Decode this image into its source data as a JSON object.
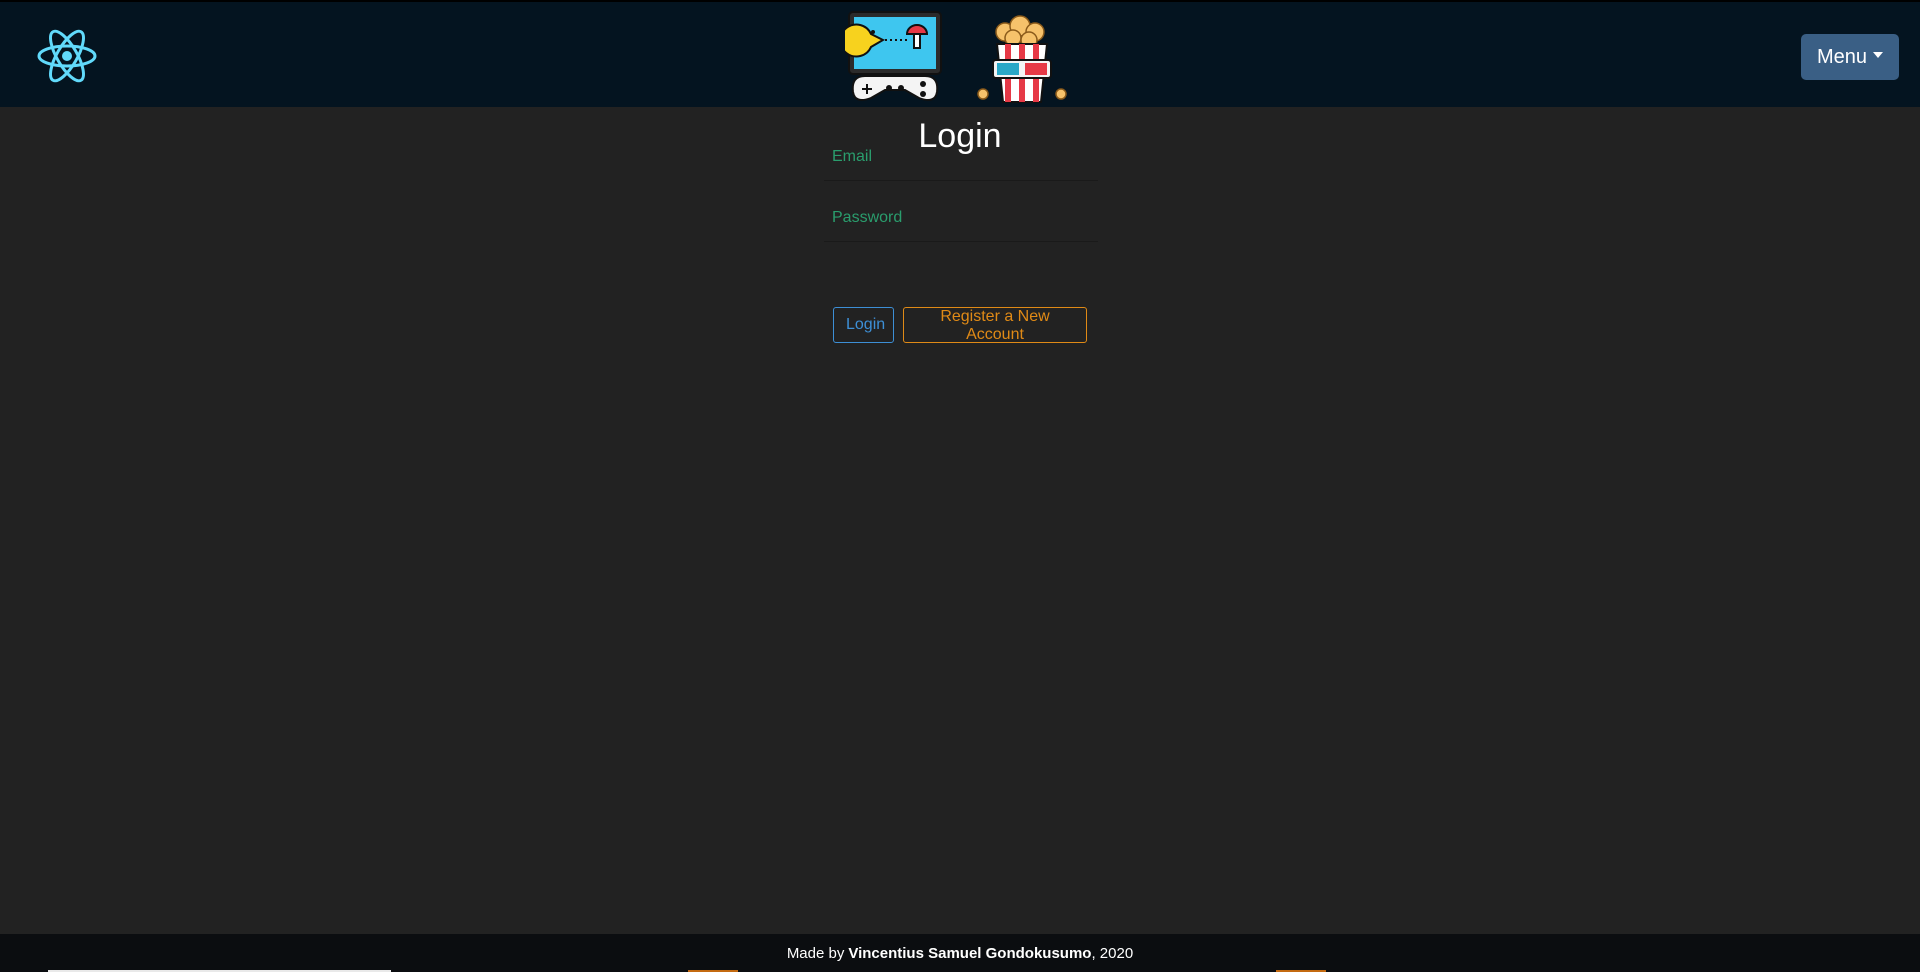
{
  "navbar": {
    "brand_icon": "react-atom-icon",
    "center_icons": [
      "gamepad-monitor-icon",
      "popcorn-3d-glasses-icon"
    ],
    "menu_label": "Menu",
    "colors": {
      "background": "#041420",
      "menu_button": "#3a5f85",
      "react_blue": "#61dafb"
    }
  },
  "login": {
    "title": "Login",
    "email_placeholder": "Email",
    "password_placeholder": "Password",
    "login_button": "Login",
    "register_button": "Register a New Account",
    "colors": {
      "placeholder": "#2a9d6d",
      "login_outline": "#3d8fd6",
      "register_outline": "#e08a16"
    }
  },
  "footer": {
    "prefix": "Made by",
    "author": "Vincentius Samuel Gondokusumo",
    "suffix": ", 2020"
  }
}
